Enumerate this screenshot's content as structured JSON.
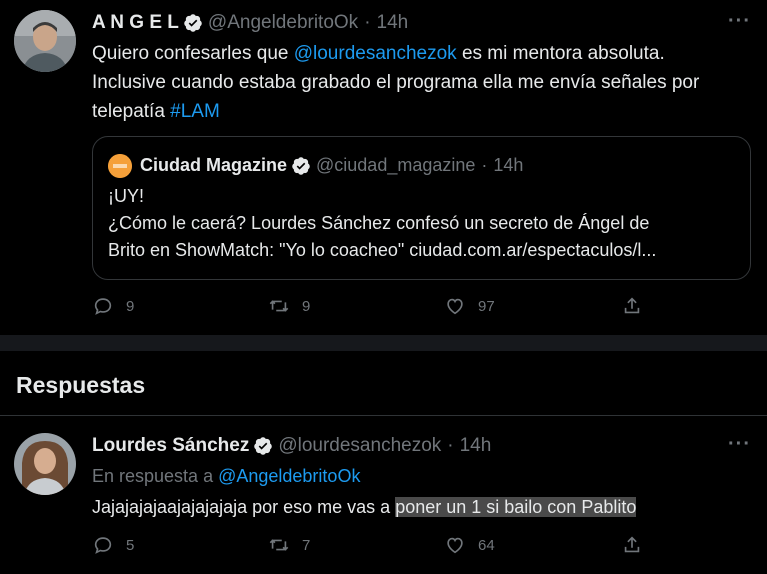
{
  "tweet": {
    "name": "A N G E L",
    "handle": "@AngeldebritoOk",
    "dot": "·",
    "time": "14h",
    "more": "···",
    "text": {
      "p1": "Quiero confesarles que ",
      "mention": "@lourdesanchezok",
      "p2": " es mi mentora absoluta.",
      "line2": "Inclusive cuando estaba grabado el programa ella me envía señales por",
      "p3": "telepatía ",
      "hashtag": "#LAM"
    },
    "quote": {
      "name": "Ciudad Magazine",
      "handle": "@ciudad_magazine",
      "dot": "·",
      "time": "14h",
      "line1": "¡UY!",
      "line2": "¿Cómo le caerá? Lourdes Sánchez confesó un secreto de Ángel de",
      "line3": "Brito en ShowMatch: \"Yo lo coacheo\" ciudad.com.ar/espectaculos/l..."
    },
    "actions": {
      "replies": "9",
      "retweets": "9",
      "likes": "97"
    }
  },
  "section": {
    "title": "Respuestas"
  },
  "reply": {
    "name": "Lourdes Sánchez",
    "handle": "@lourdesanchezok",
    "dot": "·",
    "time": "14h",
    "more": "···",
    "reply_prefix": "En respuesta a ",
    "reply_to": "@AngeldebritoOk",
    "text_plain": "Jajajajajaajajajajaja por eso me vas a ",
    "text_highlight": "poner un 1 si bailo con Pablito",
    "actions": {
      "replies": "5",
      "retweets": "7",
      "likes": "64"
    }
  },
  "colors": {
    "accent": "#1d9bf0",
    "muted": "#71767b",
    "background": "#000000",
    "highlight": "#4a4a4a"
  }
}
